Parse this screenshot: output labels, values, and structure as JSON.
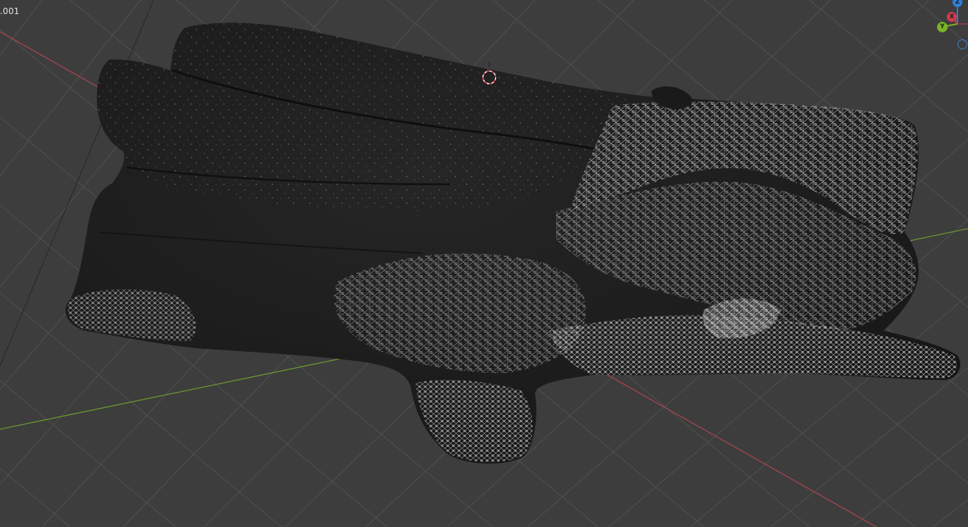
{
  "viewport": {
    "active_object_label": ".001",
    "background_color": "#3d3d3d",
    "grid_color": "#555555",
    "x_axis_color": "#a8464b",
    "y_axis_color": "#6b9a2c",
    "mesh_color": "#1b1b1b",
    "wire_color": "#bdbdbd"
  },
  "navigation_gizmo": {
    "z_label": "Z",
    "x_label": "X",
    "y_label": "Y",
    "z_color": "#2f7fd8",
    "x_color": "#d43c4e",
    "y_color": "#7ab427"
  },
  "icons": [
    "3d-cursor-icon",
    "view-toggle-icon"
  ]
}
